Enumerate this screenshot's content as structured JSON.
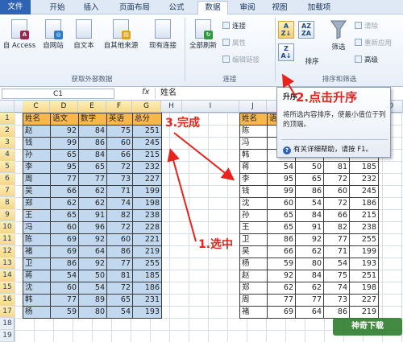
{
  "tabs": [
    {
      "label": "文件",
      "kind": "file"
    },
    {
      "label": "开始",
      "kind": ""
    },
    {
      "label": "插入",
      "kind": ""
    },
    {
      "label": "页面布局",
      "kind": ""
    },
    {
      "label": "公式",
      "kind": ""
    },
    {
      "label": "数据",
      "kind": "active"
    },
    {
      "label": "审阅",
      "kind": ""
    },
    {
      "label": "视图",
      "kind": ""
    },
    {
      "label": "加载项",
      "kind": ""
    }
  ],
  "ribbon": {
    "get_external": {
      "from_access": "自 Access",
      "from_web": "自网站",
      "from_text": "自文本",
      "from_other": "自其他来源",
      "existing_connections": "现有连接",
      "group_label": "获取外部数据"
    },
    "connections": {
      "refresh_all": "全部刷新",
      "connections": "连接",
      "properties": "属性",
      "edit_links": "编辑链接",
      "group_label": "连接"
    },
    "sort_filter": {
      "sort": "排序",
      "filter": "筛选",
      "clear": "清除",
      "reapply": "重新应用",
      "advanced": "高级",
      "group_label": "排序和筛选"
    }
  },
  "formula_bar": {
    "name_box": "C1",
    "fx": "fx",
    "content": "姓名"
  },
  "columns": [
    "C",
    "D",
    "E",
    "F",
    "G",
    "H",
    "I",
    "J",
    "K",
    "L",
    "M",
    "N",
    "O"
  ],
  "rows": [
    "1",
    "2",
    "3",
    "4",
    "5",
    "6",
    "7",
    "8",
    "9",
    "10",
    "11",
    "12",
    "13",
    "14",
    "15",
    "16",
    "17",
    "18",
    "19"
  ],
  "left_table": {
    "header": [
      "姓名",
      "语文",
      "数学",
      "英语",
      "总分"
    ],
    "rows": [
      [
        "赵",
        "92",
        "84",
        "75",
        "251"
      ],
      [
        "钱",
        "99",
        "86",
        "60",
        "245"
      ],
      [
        "孙",
        "65",
        "84",
        "66",
        "215"
      ],
      [
        "李",
        "95",
        "65",
        "72",
        "232"
      ],
      [
        "周",
        "77",
        "77",
        "73",
        "227"
      ],
      [
        "吴",
        "66",
        "62",
        "71",
        "199"
      ],
      [
        "郑",
        "62",
        "62",
        "74",
        "198"
      ],
      [
        "王",
        "65",
        "91",
        "82",
        "238"
      ],
      [
        "冯",
        "60",
        "96",
        "72",
        "228"
      ],
      [
        "陈",
        "69",
        "92",
        "60",
        "221"
      ],
      [
        "褚",
        "69",
        "64",
        "86",
        "219"
      ],
      [
        "卫",
        "86",
        "92",
        "77",
        "255"
      ],
      [
        "蒋",
        "54",
        "50",
        "81",
        "185"
      ],
      [
        "沈",
        "60",
        "54",
        "72",
        "186"
      ],
      [
        "韩",
        "77",
        "89",
        "65",
        "231"
      ],
      [
        "杨",
        "59",
        "80",
        "54",
        "193"
      ]
    ]
  },
  "right_table": {
    "header": [
      "姓名",
      "语"
    ],
    "rows": [
      [
        "陈",
        "",
        "",
        "",
        ""
      ],
      [
        "冯",
        "",
        "",
        "",
        ""
      ],
      [
        "韩",
        "77",
        "89",
        "65",
        "231"
      ],
      [
        "蒋",
        "54",
        "50",
        "81",
        "185"
      ],
      [
        "李",
        "95",
        "65",
        "72",
        "232"
      ],
      [
        "钱",
        "99",
        "86",
        "60",
        "245"
      ],
      [
        "沈",
        "60",
        "54",
        "72",
        "186"
      ],
      [
        "孙",
        "65",
        "84",
        "66",
        "215"
      ],
      [
        "王",
        "65",
        "91",
        "82",
        "238"
      ],
      [
        "卫",
        "86",
        "92",
        "77",
        "255"
      ],
      [
        "吴",
        "66",
        "62",
        "71",
        "199"
      ],
      [
        "杨",
        "59",
        "80",
        "54",
        "193"
      ],
      [
        "赵",
        "92",
        "84",
        "75",
        "251"
      ],
      [
        "郑",
        "62",
        "62",
        "74",
        "198"
      ],
      [
        "周",
        "77",
        "77",
        "73",
        "227"
      ],
      [
        "褚",
        "69",
        "64",
        "86",
        "219"
      ]
    ]
  },
  "tooltip": {
    "title": "升序",
    "body": "将所选内容排序，使最小值位于列的顶端。",
    "help": "有关详细帮助，请按 F1。"
  },
  "annotations": {
    "step1": "1.选中",
    "step2": "2.点击升序",
    "step3": "3.完成"
  },
  "watermark": "神奇下载",
  "colors": {
    "header_fill": "#f7b74a",
    "selection_fill": "#c2d8ee",
    "annotation": "#e8231c",
    "file_tab": "#2f63b5"
  }
}
